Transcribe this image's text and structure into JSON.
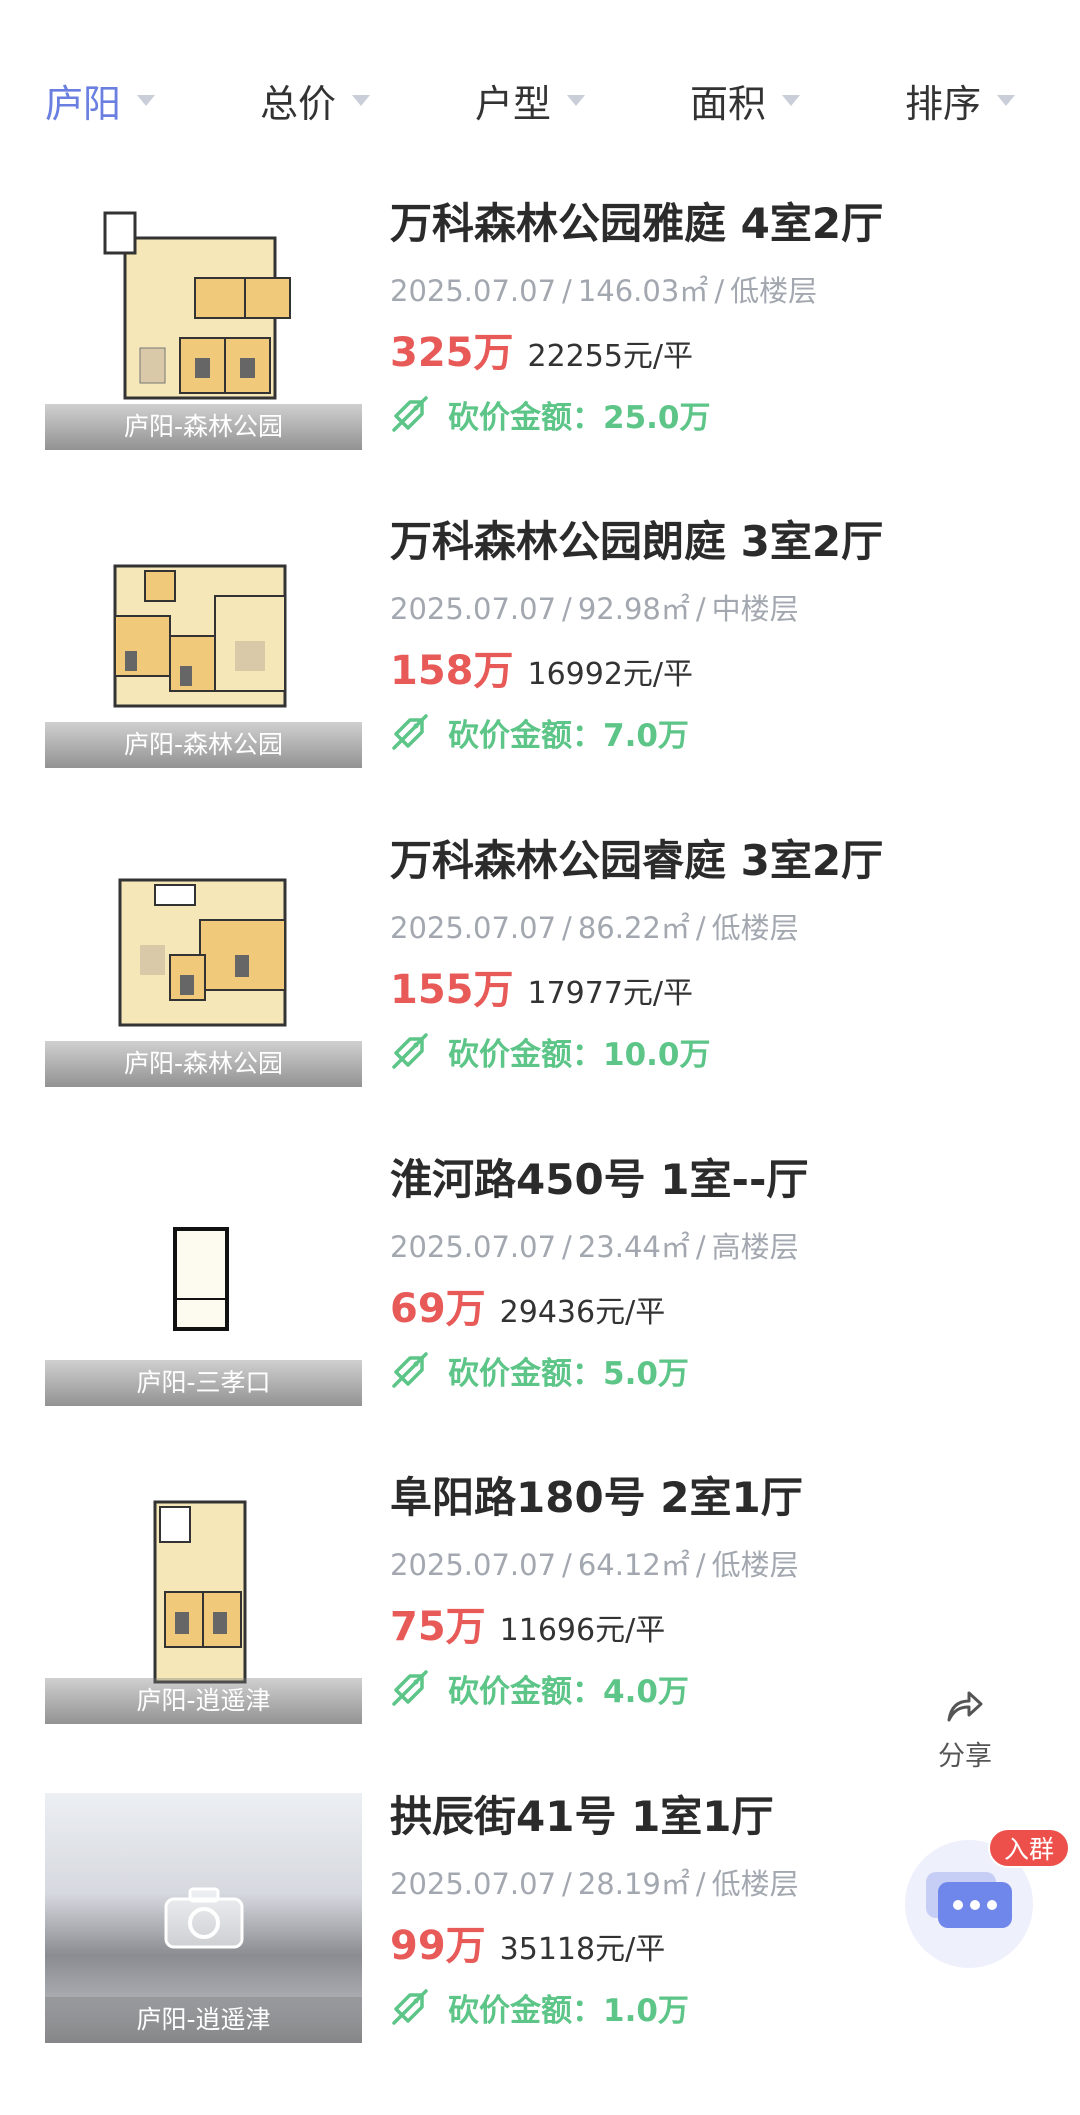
{
  "filters": [
    {
      "label": "庐阳",
      "active": true
    },
    {
      "label": "总价",
      "active": false
    },
    {
      "label": "户型",
      "active": false
    },
    {
      "label": "面积",
      "active": false
    },
    {
      "label": "排序",
      "active": false
    }
  ],
  "cut_label": "砍价金额：",
  "listings": [
    {
      "title": "万科森林公园雅庭 4室2厅",
      "date": "2025.07.07",
      "area": "146.03㎡",
      "floor": "低楼层",
      "price": "325万",
      "unit_price": "22255元/平",
      "cut": "25.0万",
      "caption": "庐阳-森林公园",
      "thumb": "floorplan-large"
    },
    {
      "title": "万科森林公园朗庭 3室2厅",
      "date": "2025.07.07",
      "area": "92.98㎡",
      "floor": "中楼层",
      "price": "158万",
      "unit_price": "16992元/平",
      "cut": "7.0万",
      "caption": "庐阳-森林公园",
      "thumb": "floorplan-wide"
    },
    {
      "title": "万科森林公园睿庭 3室2厅",
      "date": "2025.07.07",
      "area": "86.22㎡",
      "floor": "低楼层",
      "price": "155万",
      "unit_price": "17977元/平",
      "cut": "10.0万",
      "caption": "庐阳-森林公园",
      "thumb": "floorplan-wide"
    },
    {
      "title": "淮河路450号 1室--厅",
      "date": "2025.07.07",
      "area": "23.44㎡",
      "floor": "高楼层",
      "price": "69万",
      "unit_price": "29436元/平",
      "cut": "5.0万",
      "caption": "庐阳-三孝口",
      "thumb": "floorplan-small"
    },
    {
      "title": "阜阳路180号 2室1厅",
      "date": "2025.07.07",
      "area": "64.12㎡",
      "floor": "低楼层",
      "price": "75万",
      "unit_price": "11696元/平",
      "cut": "4.0万",
      "caption": "庐阳-逍遥津",
      "thumb": "floorplan-tall"
    },
    {
      "title": "拱辰街41号 1室1厅",
      "date": "2025.07.07",
      "area": "28.19㎡",
      "floor": "低楼层",
      "price": "99万",
      "unit_price": "35118元/平",
      "cut": "1.0万",
      "caption": "庐阳-逍遥津",
      "thumb": "photo-placeholder"
    }
  ],
  "share": {
    "label": "分享",
    "icon": "share-arrow-icon"
  },
  "chat": {
    "badge": "入群",
    "icon": "chat-bubble-icon"
  },
  "colors": {
    "accent": "#6a7fe0",
    "price": "#e85a58",
    "cut": "#5cc587",
    "meta": "#a3a8b0"
  }
}
